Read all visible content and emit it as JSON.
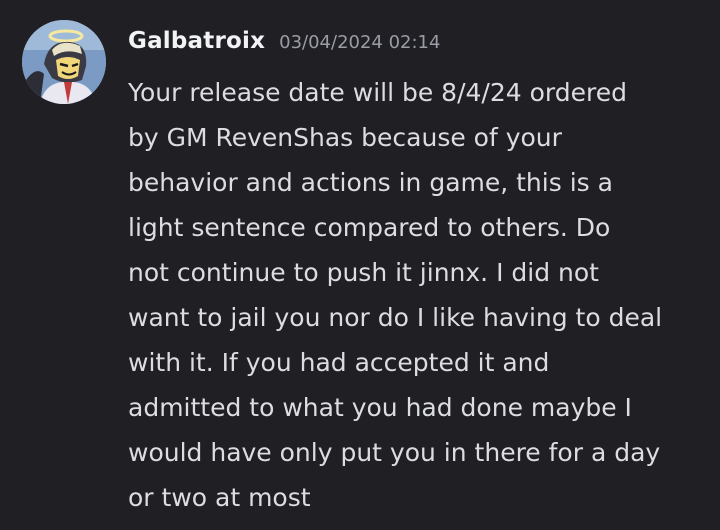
{
  "message": {
    "avatar_icon": "character-avatar-icon",
    "username": "Galbatroix",
    "timestamp": "03/04/2024 02:14",
    "text": "Your release date will be 8/4/24 ordered\nby GM RevenShas because of your\nbehavior and actions in game, this is a\nlight sentence compared to others. Do\nnot continue to push it jinnx. I did not\nwant to jail you nor do I like having to deal\nwith it. If you had accepted it and\nadmitted to what you had done maybe I\nwould have only put you in there for a day\nor two at most"
  },
  "colors": {
    "background": "#1f1f24",
    "username": "#f2f3f5",
    "timestamp": "#9a9ca6",
    "text": "#dcdde1"
  }
}
